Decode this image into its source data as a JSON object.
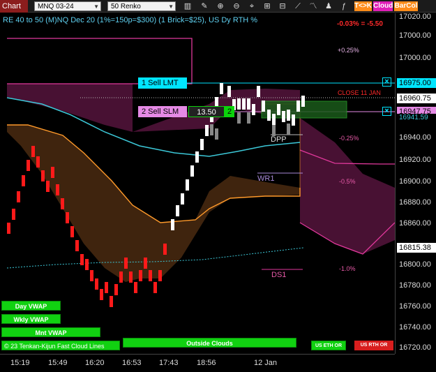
{
  "toolbar": {
    "chart_tab": "Chart",
    "instrument": "MNQ 03-24",
    "bar_type": "50 Renko",
    "btn_tk": "T<>K",
    "btn_cloud": "Cloud",
    "btn_barcol": "BarCol"
  },
  "header": {
    "title": "RE 40 to 50 (M)NQ Dec 20 (1%=150p=$300) (1 Brick=$25), US Dy RTH %",
    "change": "-0.03% = -5.50"
  },
  "orders": {
    "sell_lmt": "1 Sell LMT",
    "sell_slm": "2 Sell SLM",
    "slm_price": "13.50",
    "slm_qty": "2",
    "lmt_close": "×",
    "slm_close": "×"
  },
  "levels": {
    "close_label": "CLOSE 11 JAN",
    "dpp": "DPP",
    "wr1": "WR1",
    "ds1": "DS1",
    "pct_p025": "+0.25%",
    "pct_m025": "-0.25%",
    "pct_m05": "-0.5%",
    "pct_m1": "-1.0%"
  },
  "buttons": {
    "day_vwap": "Day VWAP",
    "wkly_vwap": "Wkly VWAP",
    "mnt_vwap": "Mnt VWAP",
    "tenkan": "© 23 Tenkan-Kijun Fast Cloud Lines",
    "outside_clouds": "Outside Clouds",
    "us_eth_or": "US ETH OR",
    "us_rth_or": "US RTH OR"
  },
  "price_axis": {
    "ticks": [
      "17020.00",
      "17000.00",
      "16980.00",
      "16960.00",
      "16940.00",
      "16920.00",
      "16900.00",
      "16880.00",
      "16860.00",
      "16840.00",
      "16820.00",
      "16800.00",
      "16780.00",
      "16760.00",
      "16740.00",
      "16720.00"
    ],
    "tag_lmt": "16975.00",
    "tag_last": "16960.75",
    "tag_slm": "16947.75",
    "tag_low": "16941.59",
    "tag_vwap": "16815.38"
  },
  "time_axis": [
    "15:19",
    "15:49",
    "16:20",
    "16:53",
    "17:43",
    "18:56",
    "12 Jan"
  ],
  "colors": {
    "up_brick": "#ffffff",
    "down_brick": "#ff1a1a",
    "sell_lmt": "#00e5ff",
    "sell_slm": "#e58ae5",
    "cloud_magenta": "#e0389b",
    "cloud_orange": "#ff9a2a",
    "cyan_line": "#3cc8d8",
    "button_green": "#11d111"
  }
}
